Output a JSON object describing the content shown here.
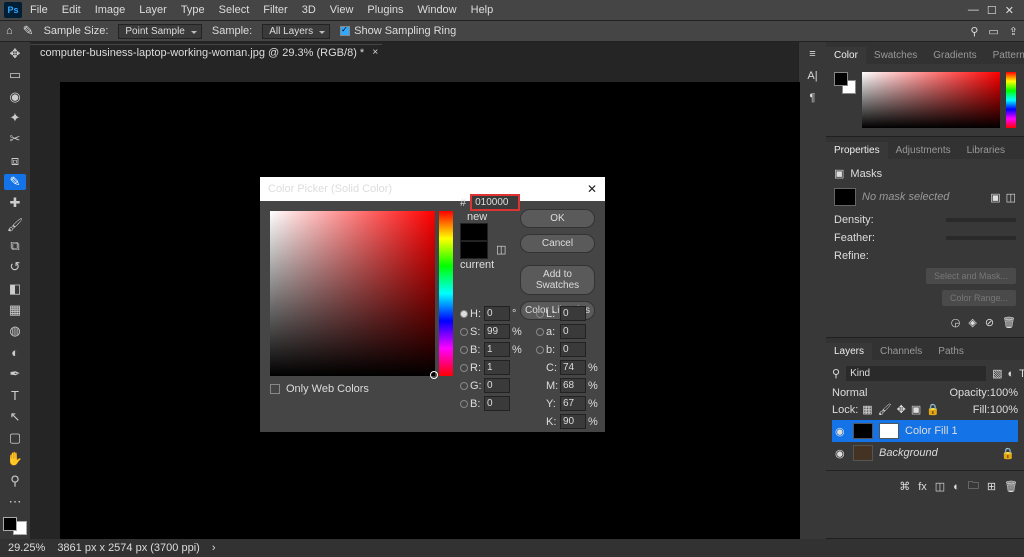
{
  "menu": [
    "File",
    "Edit",
    "Image",
    "Layer",
    "Type",
    "Select",
    "Filter",
    "3D",
    "View",
    "Plugins",
    "Window",
    "Help"
  ],
  "options": {
    "sampleSizeLabel": "Sample Size:",
    "sampleSize": "Point Sample",
    "sampleLabel": "Sample:",
    "sample": "All Layers",
    "showRing": "Show Sampling Ring"
  },
  "doc": {
    "tab": "computer-business-laptop-working-woman.jpg @ 29.3% (RGB/8) *"
  },
  "status": {
    "zoom": "29.25%",
    "dims": "3861 px x 2574 px (3700 ppi)"
  },
  "picker": {
    "title": "Color Picker (Solid Color)",
    "new": "new",
    "current": "current",
    "ok": "OK",
    "cancel": "Cancel",
    "add": "Add to Swatches",
    "lib": "Color Libraries",
    "onlyWeb": "Only Web Colors",
    "H": "0",
    "S": "99",
    "B": "1",
    "R": "1",
    "G": "0",
    "Bb": "0",
    "L": "0",
    "a": "0",
    "b2": "0",
    "C": "74",
    "M": "68",
    "Y": "67",
    "K": "90",
    "hex": "010000"
  },
  "right": {
    "colorTabs": [
      "Color",
      "Swatches",
      "Gradients",
      "Patterns"
    ],
    "propTabs": [
      "Properties",
      "Adjustments",
      "Libraries"
    ],
    "masks": "Masks",
    "noMask": "No mask selected",
    "density": "Density:",
    "feather": "Feather:",
    "refine": "Refine:",
    "selectMask": "Select and Mask...",
    "colorRange": "Color Range...",
    "layerTabs": [
      "Layers",
      "Channels",
      "Paths"
    ],
    "kind": "Kind",
    "normal": "Normal",
    "opacity": "Opacity:",
    "opv": "100%",
    "lock": "Lock:",
    "fill": "Fill:",
    "fillv": "100%",
    "layers": [
      {
        "name": "Color Fill 1",
        "active": true
      },
      {
        "name": "Background",
        "active": false
      }
    ]
  }
}
